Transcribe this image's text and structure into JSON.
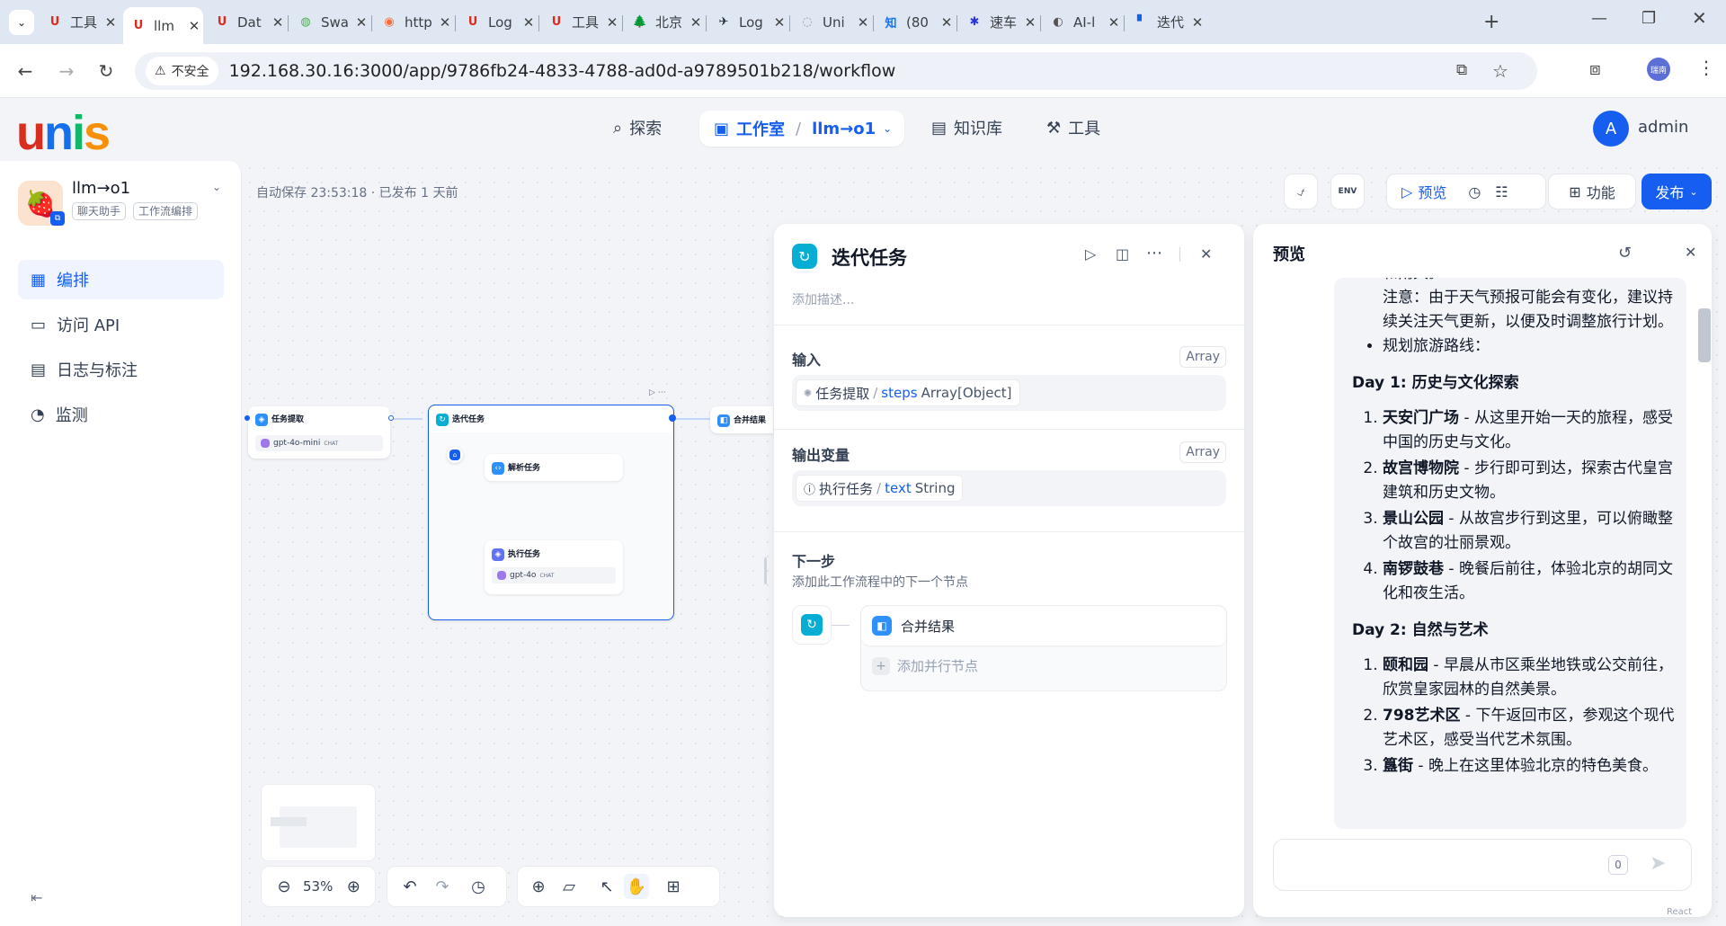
{
  "browser": {
    "tabs": [
      {
        "title": "工具",
        "favicon": "U",
        "color": "#d92d20"
      },
      {
        "title": "llm",
        "favicon": "U",
        "color": "#d92d20"
      },
      {
        "title": "Dat",
        "favicon": "U",
        "color": "#d92d20"
      },
      {
        "title": "Swa",
        "favicon": "◍",
        "color": "#4caf50"
      },
      {
        "title": "http",
        "favicon": "◉",
        "color": "#ff6d3a"
      },
      {
        "title": "Log",
        "favicon": "U",
        "color": "#d92d20"
      },
      {
        "title": "工具",
        "favicon": "U",
        "color": "#d92d20"
      },
      {
        "title": "北京",
        "favicon": "🌲",
        "color": "#444"
      },
      {
        "title": "Log",
        "favicon": "✈",
        "color": "#1d2939"
      },
      {
        "title": "Uni",
        "favicon": "◌",
        "color": "#999"
      },
      {
        "title": "(80",
        "favicon": "知",
        "color": "#1772f6"
      },
      {
        "title": "速车",
        "favicon": "✱",
        "color": "#2932e1"
      },
      {
        "title": "AI-l",
        "favicon": "◐",
        "color": "#555"
      },
      {
        "title": "迭代",
        "favicon": "▘",
        "color": "#155eef"
      }
    ],
    "insecure_label": "不安全",
    "url": "192.168.30.16:3000/app/9786fb24-4833-4788-ad0d-a9789501b218/workflow",
    "profile": "瑞南"
  },
  "header": {
    "logo": "unis",
    "nav": {
      "explore": "探索",
      "studio": "工作室",
      "app": "llm→o1",
      "knowledge": "知识库",
      "tools": "工具"
    },
    "avatar": "A",
    "username": "admin"
  },
  "sidebar": {
    "app_name": "llm→o1",
    "tags": [
      "聊天助手",
      "工作流编排"
    ],
    "items": [
      {
        "label": "编排",
        "icon": "layout-icon"
      },
      {
        "label": "访问 API",
        "icon": "terminal-icon"
      },
      {
        "label": "日志与标注",
        "icon": "file-icon"
      },
      {
        "label": "监测",
        "icon": "gauge-icon"
      }
    ]
  },
  "toolbar": {
    "autosave": "自动保存 23:53:18 · 已发布 1 天前",
    "env": "ENV",
    "preview": "预览",
    "features": "功能",
    "publish": "发布"
  },
  "canvas": {
    "node_extract": "任务提取",
    "node_extract_model": "gpt-4o-mini",
    "node_iter": "迭代任务",
    "node_parse": "解析任务",
    "node_exec": "执行任务",
    "node_exec_model": "gpt-4o",
    "node_merge": "合并结果",
    "chat_tag": "CHAT",
    "zoom": "53%"
  },
  "panel": {
    "title": "迭代任务",
    "desc_placeholder": "添加描述...",
    "input_label": "输入",
    "input_type": "Array",
    "input_node": "任务提取",
    "input_var": "steps",
    "input_var_type": "Array[Object]",
    "output_label": "输出变量",
    "output_type": "Array",
    "output_node": "执行任务",
    "output_var": "text",
    "output_var_type": "String",
    "next_label": "下一步",
    "next_desc": "添加此工作流程中的下一个节点",
    "next_node": "合并结果",
    "add_parallel": "添加并行节点"
  },
  "preview": {
    "title": "预览",
    "top_fragment": "和雨具。",
    "note": "注意：由于天气预报可能会有变化，建议持续关注天气更新，以便及时调整旅行计划。",
    "bullet": "规划旅游路线：",
    "day1_title": "Day 1: 历史与文化探索",
    "day1": [
      {
        "name": "天安门广场",
        "text": " - 从这里开始一天的旅程，感受中国的历史与文化。"
      },
      {
        "name": "故宫博物院",
        "text": " - 步行即可到达，探索古代皇宫建筑和历史文物。"
      },
      {
        "name": "景山公园",
        "text": " - 从故宫步行到这里，可以俯瞰整个故宫的壮丽景观。"
      },
      {
        "name": "南锣鼓巷",
        "text": " - 晚餐后前往，体验北京的胡同文化和夜生活。"
      }
    ],
    "day2_title": "Day 2: 自然与艺术",
    "day2": [
      {
        "name": "颐和园",
        "text": " - 早晨从市区乘坐地铁或公交前往，欣赏皇家园林的自然美景。"
      },
      {
        "name": "798艺术区",
        "text": " - 下午返回市区，参观这个现代艺术区，感受当代艺术氛围。"
      },
      {
        "name": "簋街",
        "text": " - 晚上在这里体验北京的特色美食。"
      }
    ],
    "char_count": "0",
    "footer_mark": "React Flow"
  }
}
